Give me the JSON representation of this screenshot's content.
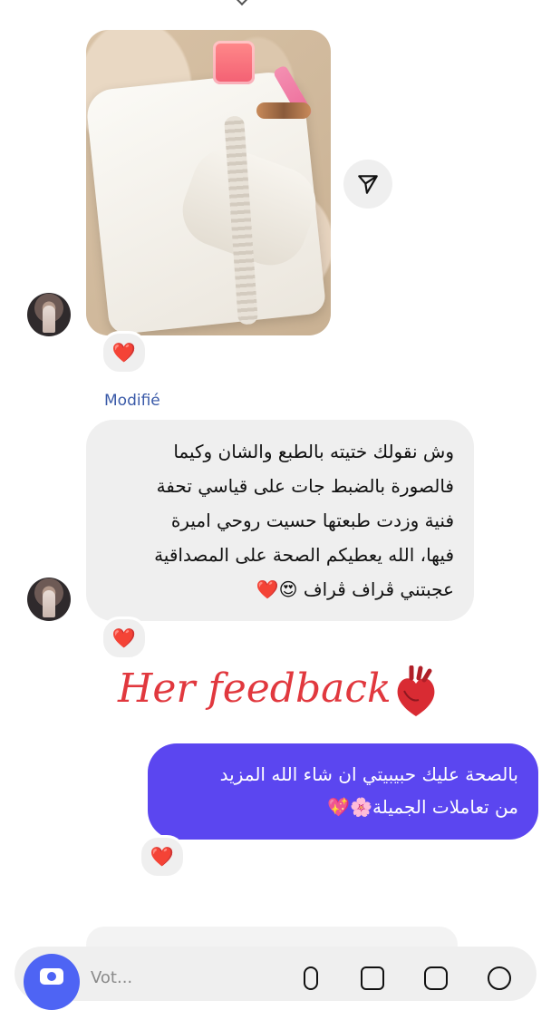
{
  "conversation": {
    "photo_reaction": "❤️",
    "edited_label": "Modifié",
    "incoming_message": {
      "lines": [
        "وش نقولك ختيته بالطبع والشان وكيما",
        "فالصورة بالضبط جات على قياسي تحفة",
        "فنية وزدت طبعتها حسيت روحي اميرة",
        "فيها، الله يعطيكم الصحة على المصداقية",
        "عجبتني ڤراف ڤراف"
      ],
      "emoji_tail": "😍❤️",
      "reaction": "❤️"
    },
    "caption": "Her feedback",
    "outgoing_message": {
      "lines": [
        "بالصحة عليك حبيبيتي ان شاء الله المزيد",
        "من تعاملات الجميلة🌸💖"
      ],
      "reaction": "❤️"
    }
  },
  "composer": {
    "placeholder": "Vot..."
  },
  "colors": {
    "outgoing_bubble": "#5b46f0",
    "incoming_bubble": "#efefef",
    "caption": "#e1383e",
    "edited_label": "#3a5aa8",
    "camera_button": "#4e64f4"
  },
  "icons": {
    "share": "send-icon",
    "camera": "camera-icon",
    "mic": "mic-icon",
    "gallery": "gallery-icon",
    "sticker": "sticker-icon",
    "more": "plus-icon"
  }
}
